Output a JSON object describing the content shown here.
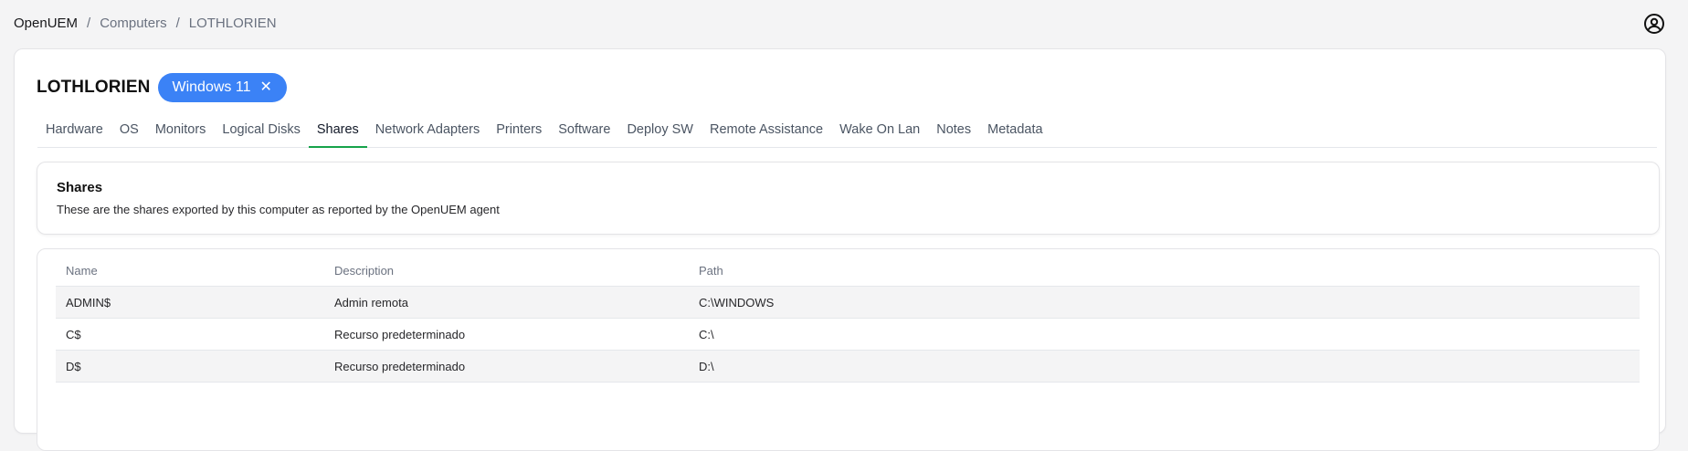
{
  "breadcrumb": {
    "items": [
      "OpenUEM",
      "Computers",
      "LOTHLORIEN"
    ],
    "separator": "/"
  },
  "header": {
    "user_icon": "user-circle-icon"
  },
  "device": {
    "name": "LOTHLORIEN",
    "os_badge": "Windows 11",
    "os_badge_close": "✕",
    "badge_color": "#3b82f6"
  },
  "tabs": [
    {
      "label": "Hardware"
    },
    {
      "label": "OS"
    },
    {
      "label": "Monitors"
    },
    {
      "label": "Logical Disks"
    },
    {
      "label": "Shares",
      "active": true
    },
    {
      "label": "Network Adapters"
    },
    {
      "label": "Printers"
    },
    {
      "label": "Software"
    },
    {
      "label": "Deploy SW"
    },
    {
      "label": "Remote Assistance"
    },
    {
      "label": "Wake On Lan"
    },
    {
      "label": "Notes"
    },
    {
      "label": "Metadata"
    }
  ],
  "active_tab_color": "#16a34a",
  "info": {
    "title": "Shares",
    "description": "These are the shares exported by this computer as reported by the OpenUEM agent"
  },
  "table": {
    "columns": [
      "Name",
      "Description",
      "Path"
    ],
    "rows": [
      {
        "name": "ADMIN$",
        "description": "Admin remota",
        "path": "C:\\WINDOWS"
      },
      {
        "name": "C$",
        "description": "Recurso predeterminado",
        "path": "C:\\"
      },
      {
        "name": "D$",
        "description": "Recurso predeterminado",
        "path": "D:\\"
      }
    ]
  }
}
